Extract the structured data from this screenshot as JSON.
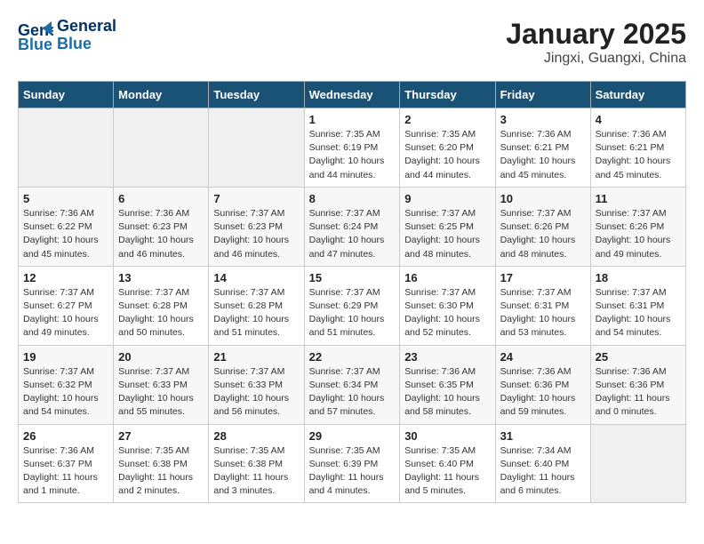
{
  "header": {
    "logo_line1": "General",
    "logo_line2": "Blue",
    "month": "January 2025",
    "location": "Jingxi, Guangxi, China"
  },
  "weekdays": [
    "Sunday",
    "Monday",
    "Tuesday",
    "Wednesday",
    "Thursday",
    "Friday",
    "Saturday"
  ],
  "weeks": [
    [
      {
        "day": "",
        "info": ""
      },
      {
        "day": "",
        "info": ""
      },
      {
        "day": "",
        "info": ""
      },
      {
        "day": "1",
        "info": "Sunrise: 7:35 AM\nSunset: 6:19 PM\nDaylight: 10 hours\nand 44 minutes."
      },
      {
        "day": "2",
        "info": "Sunrise: 7:35 AM\nSunset: 6:20 PM\nDaylight: 10 hours\nand 44 minutes."
      },
      {
        "day": "3",
        "info": "Sunrise: 7:36 AM\nSunset: 6:21 PM\nDaylight: 10 hours\nand 45 minutes."
      },
      {
        "day": "4",
        "info": "Sunrise: 7:36 AM\nSunset: 6:21 PM\nDaylight: 10 hours\nand 45 minutes."
      }
    ],
    [
      {
        "day": "5",
        "info": "Sunrise: 7:36 AM\nSunset: 6:22 PM\nDaylight: 10 hours\nand 45 minutes."
      },
      {
        "day": "6",
        "info": "Sunrise: 7:36 AM\nSunset: 6:23 PM\nDaylight: 10 hours\nand 46 minutes."
      },
      {
        "day": "7",
        "info": "Sunrise: 7:37 AM\nSunset: 6:23 PM\nDaylight: 10 hours\nand 46 minutes."
      },
      {
        "day": "8",
        "info": "Sunrise: 7:37 AM\nSunset: 6:24 PM\nDaylight: 10 hours\nand 47 minutes."
      },
      {
        "day": "9",
        "info": "Sunrise: 7:37 AM\nSunset: 6:25 PM\nDaylight: 10 hours\nand 48 minutes."
      },
      {
        "day": "10",
        "info": "Sunrise: 7:37 AM\nSunset: 6:26 PM\nDaylight: 10 hours\nand 48 minutes."
      },
      {
        "day": "11",
        "info": "Sunrise: 7:37 AM\nSunset: 6:26 PM\nDaylight: 10 hours\nand 49 minutes."
      }
    ],
    [
      {
        "day": "12",
        "info": "Sunrise: 7:37 AM\nSunset: 6:27 PM\nDaylight: 10 hours\nand 49 minutes."
      },
      {
        "day": "13",
        "info": "Sunrise: 7:37 AM\nSunset: 6:28 PM\nDaylight: 10 hours\nand 50 minutes."
      },
      {
        "day": "14",
        "info": "Sunrise: 7:37 AM\nSunset: 6:28 PM\nDaylight: 10 hours\nand 51 minutes."
      },
      {
        "day": "15",
        "info": "Sunrise: 7:37 AM\nSunset: 6:29 PM\nDaylight: 10 hours\nand 51 minutes."
      },
      {
        "day": "16",
        "info": "Sunrise: 7:37 AM\nSunset: 6:30 PM\nDaylight: 10 hours\nand 52 minutes."
      },
      {
        "day": "17",
        "info": "Sunrise: 7:37 AM\nSunset: 6:31 PM\nDaylight: 10 hours\nand 53 minutes."
      },
      {
        "day": "18",
        "info": "Sunrise: 7:37 AM\nSunset: 6:31 PM\nDaylight: 10 hours\nand 54 minutes."
      }
    ],
    [
      {
        "day": "19",
        "info": "Sunrise: 7:37 AM\nSunset: 6:32 PM\nDaylight: 10 hours\nand 54 minutes."
      },
      {
        "day": "20",
        "info": "Sunrise: 7:37 AM\nSunset: 6:33 PM\nDaylight: 10 hours\nand 55 minutes."
      },
      {
        "day": "21",
        "info": "Sunrise: 7:37 AM\nSunset: 6:33 PM\nDaylight: 10 hours\nand 56 minutes."
      },
      {
        "day": "22",
        "info": "Sunrise: 7:37 AM\nSunset: 6:34 PM\nDaylight: 10 hours\nand 57 minutes."
      },
      {
        "day": "23",
        "info": "Sunrise: 7:36 AM\nSunset: 6:35 PM\nDaylight: 10 hours\nand 58 minutes."
      },
      {
        "day": "24",
        "info": "Sunrise: 7:36 AM\nSunset: 6:36 PM\nDaylight: 10 hours\nand 59 minutes."
      },
      {
        "day": "25",
        "info": "Sunrise: 7:36 AM\nSunset: 6:36 PM\nDaylight: 11 hours\nand 0 minutes."
      }
    ],
    [
      {
        "day": "26",
        "info": "Sunrise: 7:36 AM\nSunset: 6:37 PM\nDaylight: 11 hours\nand 1 minute."
      },
      {
        "day": "27",
        "info": "Sunrise: 7:35 AM\nSunset: 6:38 PM\nDaylight: 11 hours\nand 2 minutes."
      },
      {
        "day": "28",
        "info": "Sunrise: 7:35 AM\nSunset: 6:38 PM\nDaylight: 11 hours\nand 3 minutes."
      },
      {
        "day": "29",
        "info": "Sunrise: 7:35 AM\nSunset: 6:39 PM\nDaylight: 11 hours\nand 4 minutes."
      },
      {
        "day": "30",
        "info": "Sunrise: 7:35 AM\nSunset: 6:40 PM\nDaylight: 11 hours\nand 5 minutes."
      },
      {
        "day": "31",
        "info": "Sunrise: 7:34 AM\nSunset: 6:40 PM\nDaylight: 11 hours\nand 6 minutes."
      },
      {
        "day": "",
        "info": ""
      }
    ]
  ]
}
